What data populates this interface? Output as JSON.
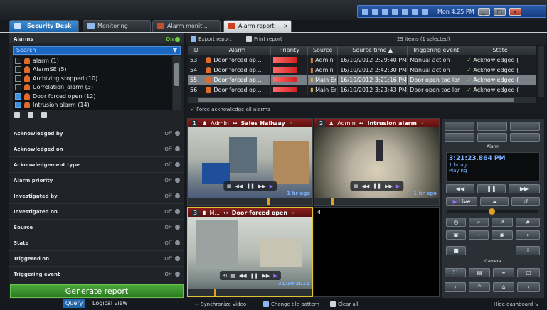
{
  "window": {
    "clock": "Mon 4:25 PM"
  },
  "tabs": [
    {
      "label": "Security Desk"
    },
    {
      "label": "Monitoring"
    },
    {
      "label": "Alarm monit..."
    },
    {
      "label": "Alarm report"
    }
  ],
  "alarms_panel": {
    "title": "Alarms",
    "toggle": "On",
    "search_placeholder": "Search",
    "items": [
      {
        "label": "alarm (1)",
        "checked": false
      },
      {
        "label": "AlarmSE (5)",
        "checked": false
      },
      {
        "label": "Archiving stopped (10)",
        "checked": false
      },
      {
        "label": "Correlation_alarm (3)",
        "checked": false
      },
      {
        "label": "Door forced open (12)",
        "checked": true
      },
      {
        "label": "Intrusion alarm (14)",
        "checked": true
      }
    ]
  },
  "filters": [
    {
      "label": "Acknowledged by",
      "state": "Off"
    },
    {
      "label": "Acknowledged on",
      "state": "Off"
    },
    {
      "label": "Acknowledgement type",
      "state": "Off"
    },
    {
      "label": "Alarm priority",
      "state": "Off"
    },
    {
      "label": "Investigated by",
      "state": "Off"
    },
    {
      "label": "Investigated on",
      "state": "Off"
    },
    {
      "label": "Source",
      "state": "Off"
    },
    {
      "label": "State",
      "state": "Off"
    },
    {
      "label": "Triggered on",
      "state": "Off"
    },
    {
      "label": "Triggering event",
      "state": "Off"
    }
  ],
  "generate_button": "Generate report",
  "view_tabs": {
    "query": "Query",
    "logical": "Logical view"
  },
  "toolbar": {
    "export": "Export report",
    "print": "Print report",
    "count": "29 items (1 selected)"
  },
  "table": {
    "headers": [
      "ID",
      "Alarm",
      "Priority",
      "Source",
      "Source time ▲",
      "Triggering event",
      "State"
    ],
    "rows": [
      {
        "id": "53",
        "alarm": "Door forced op...",
        "source": "Admin",
        "time": "16/10/2012 2:29:40 PM",
        "event": "Manual action",
        "state": "Acknowledged (",
        "selected": false
      },
      {
        "id": "54",
        "alarm": "Door forced op...",
        "source": "Admin",
        "time": "16/10/2012 2:42:30 PM",
        "event": "Manual action",
        "state": "Acknowledged (",
        "selected": false
      },
      {
        "id": "55",
        "alarm": "Door forced op...",
        "source": "Main Er",
        "time": "16/10/2012 3:21:16 PM",
        "event": "Door open too lor",
        "state": "Acknowledged (",
        "selected": true
      },
      {
        "id": "56",
        "alarm": "Door forced op...",
        "source": "Main Er",
        "time": "16/10/2012 3:23:43 PM",
        "event": "Door open too lor",
        "state": "Acknowledged (",
        "selected": false
      }
    ]
  },
  "force_ack": "Force acknowledge all alarms",
  "tiles": [
    {
      "num": "1",
      "user": "Admin",
      "name": "Sales Hallway",
      "ago": "1 hr ago"
    },
    {
      "num": "2",
      "user": "Admin",
      "name": "Intrusion alarm",
      "ago": "1 hr ago"
    },
    {
      "num": "3",
      "user": "M...",
      "name": "Door forced open",
      "ago": "31/10/2012"
    },
    {
      "num": "4",
      "user": "",
      "name": "",
      "ago": ""
    }
  ],
  "right_panel": {
    "alarm_label": "Alarm",
    "time": "3:21:23.864 PM",
    "ago": "1 hr ago",
    "status": "Playing",
    "live": "Live",
    "camera_label": "Camera"
  },
  "bottom": {
    "sync": "Synchronize video",
    "pattern": "Change tile pattern",
    "clear": "Clear all",
    "hide": "Hide dashboard"
  }
}
